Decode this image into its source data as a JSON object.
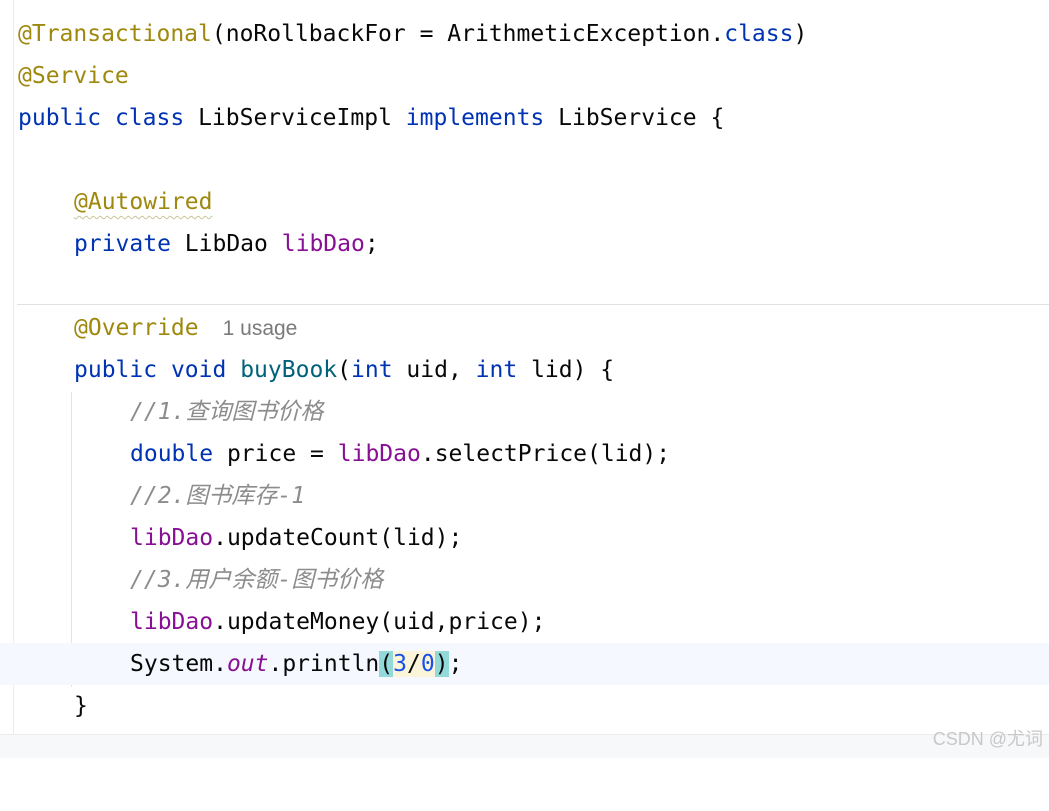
{
  "editor": {
    "class_annotations": {
      "transactional": "@Transactional",
      "transactional_args_open": "(noRollbackFor = ArithmeticException.",
      "transactional_class_kw": "class",
      "transactional_close": ")",
      "service": "@Service"
    },
    "class_decl": {
      "kw_public": "public",
      "kw_class": "class",
      "name": "LibServiceImpl",
      "kw_implements": "implements",
      "interface": "LibService",
      "brace": "{"
    },
    "field_block": {
      "annotation": "@Autowired",
      "kw_private": "private",
      "type": "LibDao",
      "name": "libDao",
      "semi": ";"
    },
    "method": {
      "annotation": "@Override",
      "usage_hint": "1 usage",
      "kw_public": "public",
      "kw_void": "void",
      "name": "buyBook",
      "open_paren": "(",
      "kw_int_1": "int",
      "param_uid": "uid,",
      "kw_int_2": "int",
      "param_lid": "lid) {",
      "comment_1_prefix": "//1.",
      "comment_1_text": "查询图书价格",
      "stmt_1_type": "double",
      "stmt_1_mid": "price =",
      "stmt_1_field": "libDao",
      "stmt_1_call": ".selectPrice(lid);",
      "comment_2_prefix": "//2.",
      "comment_2_text": "图书库存",
      "comment_2_suffix": "-1",
      "stmt_2_field": "libDao",
      "stmt_2_call": ".updateCount(lid);",
      "comment_3_prefix": "//3.",
      "comment_3_text": "用户余额",
      "comment_3_dash": "-",
      "comment_3_text2": "图书价格",
      "stmt_3_field": "libDao",
      "stmt_3_call": ".updateMoney(uid,price);",
      "stmt_4_system": "System.",
      "stmt_4_out": "out",
      "stmt_4_println": ".println",
      "stmt_4_open": "(",
      "stmt_4_num1": "3",
      "stmt_4_slash": "/",
      "stmt_4_num2": "0",
      "stmt_4_close": ")",
      "stmt_4_semi": ";",
      "close_brace": "}"
    }
  },
  "watermark": "CSDN @尤词"
}
